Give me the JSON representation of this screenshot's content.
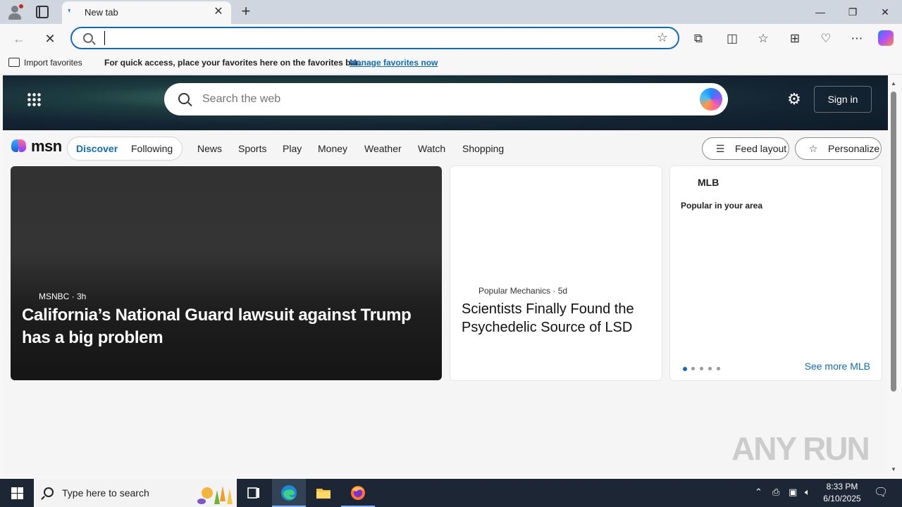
{
  "browser": {
    "tab": {
      "title": "New tab"
    },
    "address": {
      "value": "",
      "placeholder": ""
    },
    "favorites_bar": {
      "import_label": "Import favorites",
      "message": "For quick access, place your favorites here on the favorites bar.",
      "manage_link": "Manage favorites now"
    }
  },
  "msn": {
    "search_placeholder": "Search the web",
    "sign_in": "Sign in",
    "logo_text": "msn",
    "pills": {
      "discover": "Discover",
      "following": "Following"
    },
    "categories": [
      "News",
      "Sports",
      "Play",
      "Money",
      "Weather",
      "Watch",
      "Shopping"
    ],
    "feed_layout": "Feed layout",
    "personalize": "Personalize",
    "hero_card": {
      "source": "MSNBC · 3h",
      "title": "California’s National Guard lawsuit against Trump has a big problem"
    },
    "mid_card": {
      "source": "Popular Mechanics · 5d",
      "title": "Scientists Finally Found the Psychedelic Source of LSD"
    },
    "mlb_card": {
      "title": "MLB",
      "subtitle": "Popular in your area",
      "see_more": "See more MLB",
      "pages": 5,
      "active_page": 1
    }
  },
  "watermark": "ANY RUN",
  "taskbar": {
    "search_placeholder": "Type here to search",
    "time": "8:33 PM",
    "date": "6/10/2025"
  },
  "colors": {
    "accent": "#0f6cbd",
    "taskbar": "#1c2634",
    "hero_band": "#142432"
  }
}
